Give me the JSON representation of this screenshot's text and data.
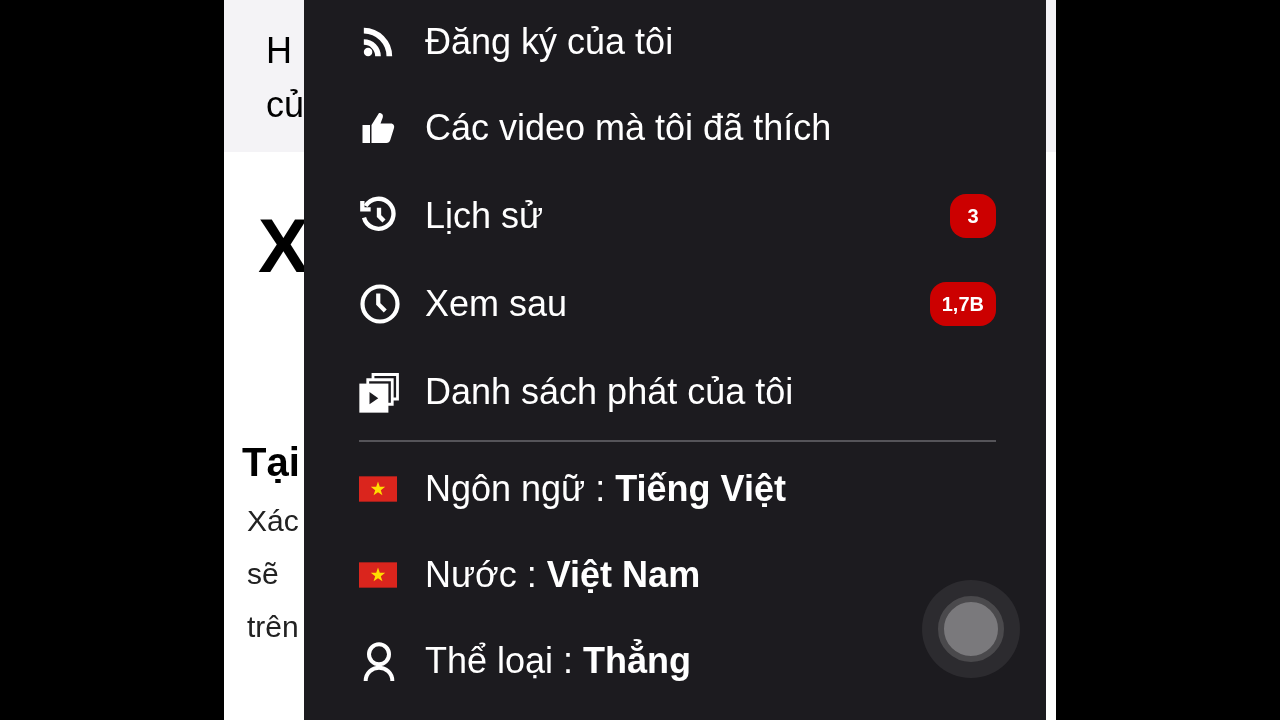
{
  "page": {
    "header_lines": [
      "H",
      "củ"
    ],
    "big_letter": "X",
    "heading": "Tại",
    "body_lines": [
      "Xác",
      "sẽ",
      "trên"
    ]
  },
  "menu": {
    "items": [
      {
        "kind": "feed",
        "label": "Đăng ký của tôi"
      },
      {
        "kind": "like",
        "label": "Các video mà tôi đã thích"
      },
      {
        "kind": "history",
        "label": "Lịch sử",
        "badge": "3"
      },
      {
        "kind": "clock",
        "label": "Xem sau",
        "badge": "1,7B"
      },
      {
        "kind": "playlist",
        "label": "Danh sách phát của tôi"
      }
    ],
    "settings": [
      {
        "kind": "flag",
        "label": "Ngôn ngữ :",
        "value": "Tiếng Việt"
      },
      {
        "kind": "flag",
        "label": "Nước :",
        "value": "Việt Nam"
      },
      {
        "kind": "person",
        "label": "Thể loại :",
        "value": "Thẳng"
      }
    ]
  }
}
